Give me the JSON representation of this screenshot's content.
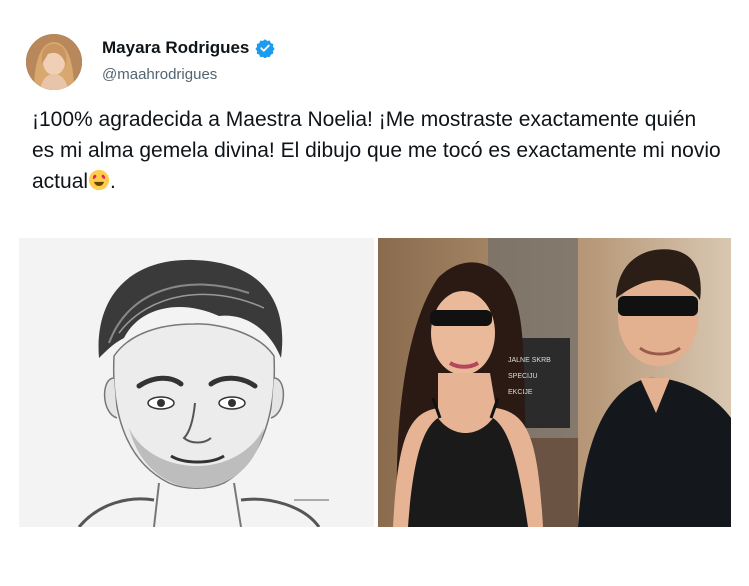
{
  "tweet": {
    "author_name": "Mayara Rodrigues",
    "handle": "@maahrodrigues",
    "text": "¡100% agradecida a Maestra Noelia! ¡Me mostraste exactamente quién es mi alma gemela divina! El dibujo que me tocó es exactamente mi novio actual",
    "text_end": ".",
    "emoji": "smiling-face-with-heart-eyes",
    "verified_color": "#1d9bf0"
  },
  "media": {
    "photo_sign_lines": [
      "JALNE SKRB",
      "SPECIJU",
      "EKCIJE"
    ]
  }
}
